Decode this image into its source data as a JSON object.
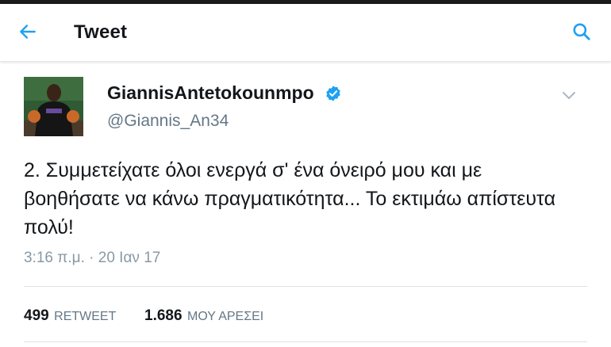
{
  "header": {
    "title": "Tweet",
    "back_icon": "arrow-left-icon",
    "search_icon": "search-icon",
    "accent_color": "#1da1f2"
  },
  "tweet": {
    "display_name": "GiannisAntetokounmpo",
    "handle": "@Giannis_An34",
    "verified": true,
    "text": "2. Συμμετείχατε όλοι ενεργά σ' ένα όνειρό μου και με βοηθήσατε να κάνω πραγματικότητα... Το εκτιμάω απίστευτα πολύ!",
    "timestamp": "3:16 π.μ. · 20 Ιαν 17"
  },
  "stats": {
    "retweets_count": "499",
    "retweets_label": "RETWEET",
    "likes_count": "1.686",
    "likes_label": "ΜΟΥ ΑΡΕΣΕΙ"
  }
}
